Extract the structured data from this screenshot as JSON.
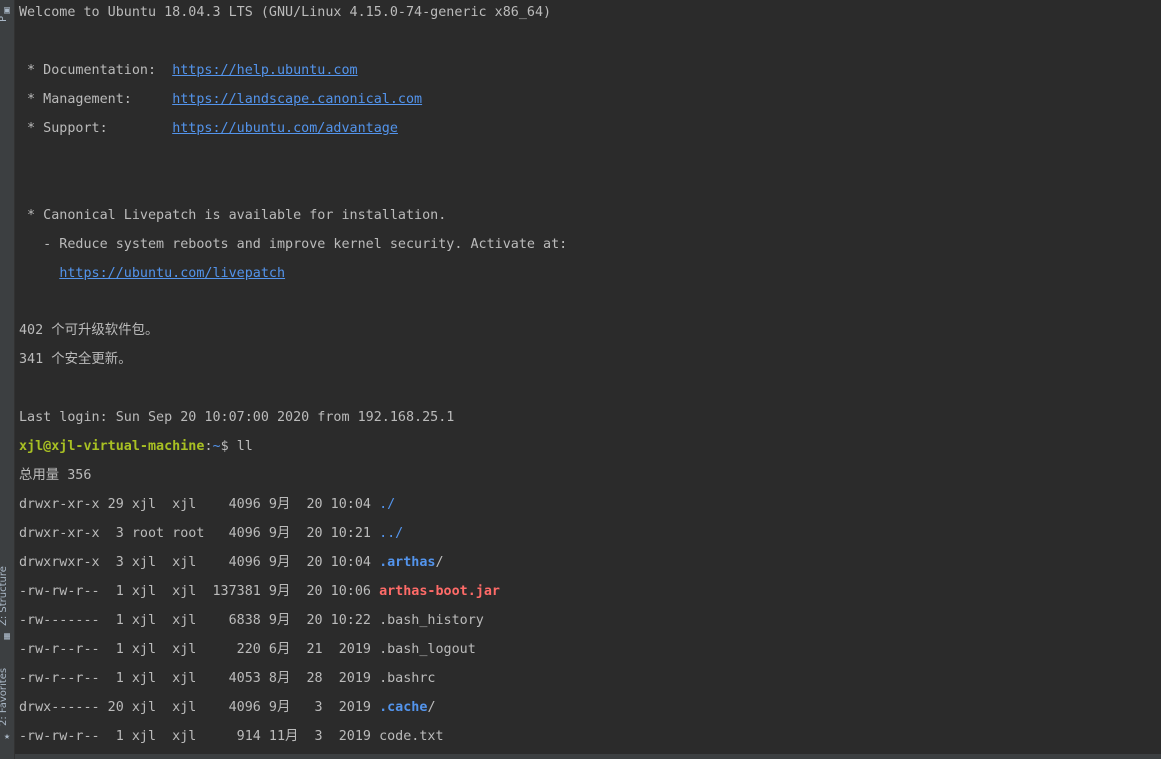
{
  "sidebar": {
    "top_label": "P",
    "structure_label": "Z: Structure",
    "favorites_label": "2: Favorites"
  },
  "terminal": {
    "welcome": "Welcome to Ubuntu 18.04.3 LTS (GNU/Linux 4.15.0-74-generic x86_64)",
    "docs": {
      "prefix": " * Documentation:  ",
      "url": "https://help.ubuntu.com"
    },
    "management": {
      "prefix": " * Management:     ",
      "url": "https://landscape.canonical.com"
    },
    "support": {
      "prefix": " * Support:        ",
      "url": "https://ubuntu.com/advantage"
    },
    "livepatch_available": " * Canonical Livepatch is available for installation.",
    "livepatch_reduce": "   - Reduce system reboots and improve kernel security. Activate at:",
    "livepatch_url_indent": "     ",
    "livepatch_url": "https://ubuntu.com/livepatch",
    "upgradable": "402 个可升级软件包。",
    "security_updates": "341 个安全更新。",
    "last_login": "Last login: Sun Sep 20 10:07:00 2020 from 192.168.25.1",
    "prompt": {
      "user_host": "xjl@xjl-virtual-machine",
      "colon": ":",
      "path": "~",
      "dollar": "$ ",
      "command": "ll"
    },
    "total": "总用量 356",
    "listing": [
      {
        "meta": "drwxr-xr-x 29 xjl  xjl    4096 9月  20 10:04 ",
        "name": "./",
        "kind": "plain-dir"
      },
      {
        "meta": "drwxr-xr-x  3 root root   4096 9月  20 10:21 ",
        "name": "../",
        "kind": "plain-dir"
      },
      {
        "meta": "drwxrwxr-x  3 xjl  xjl    4096 9月  20 10:04 ",
        "name": ".arthas",
        "suffix": "/",
        "kind": "dir"
      },
      {
        "meta": "-rw-rw-r--  1 xjl  xjl  137381 9月  20 10:06 ",
        "name": "arthas-boot.jar",
        "kind": "jar"
      },
      {
        "meta": "-rw-------  1 xjl  xjl    6838 9月  20 10:22 ",
        "name": ".bash_history",
        "kind": "file"
      },
      {
        "meta": "-rw-r--r--  1 xjl  xjl     220 6月  21  2019 ",
        "name": ".bash_logout",
        "kind": "file"
      },
      {
        "meta": "-rw-r--r--  1 xjl  xjl    4053 8月  28  2019 ",
        "name": ".bashrc",
        "kind": "file"
      },
      {
        "meta": "drwx------ 20 xjl  xjl    4096 9月   3  2019 ",
        "name": ".cache",
        "suffix": "/",
        "kind": "dir"
      },
      {
        "meta": "-rw-rw-r--  1 xjl  xjl     914 11月  3  2019 ",
        "name": "code.txt",
        "kind": "file"
      }
    ]
  },
  "colors": {
    "background": "#2b2b2b",
    "text": "#bbbbbb",
    "link": "#5394ec",
    "user": "#a8c023",
    "jar": "#ff6b68"
  }
}
